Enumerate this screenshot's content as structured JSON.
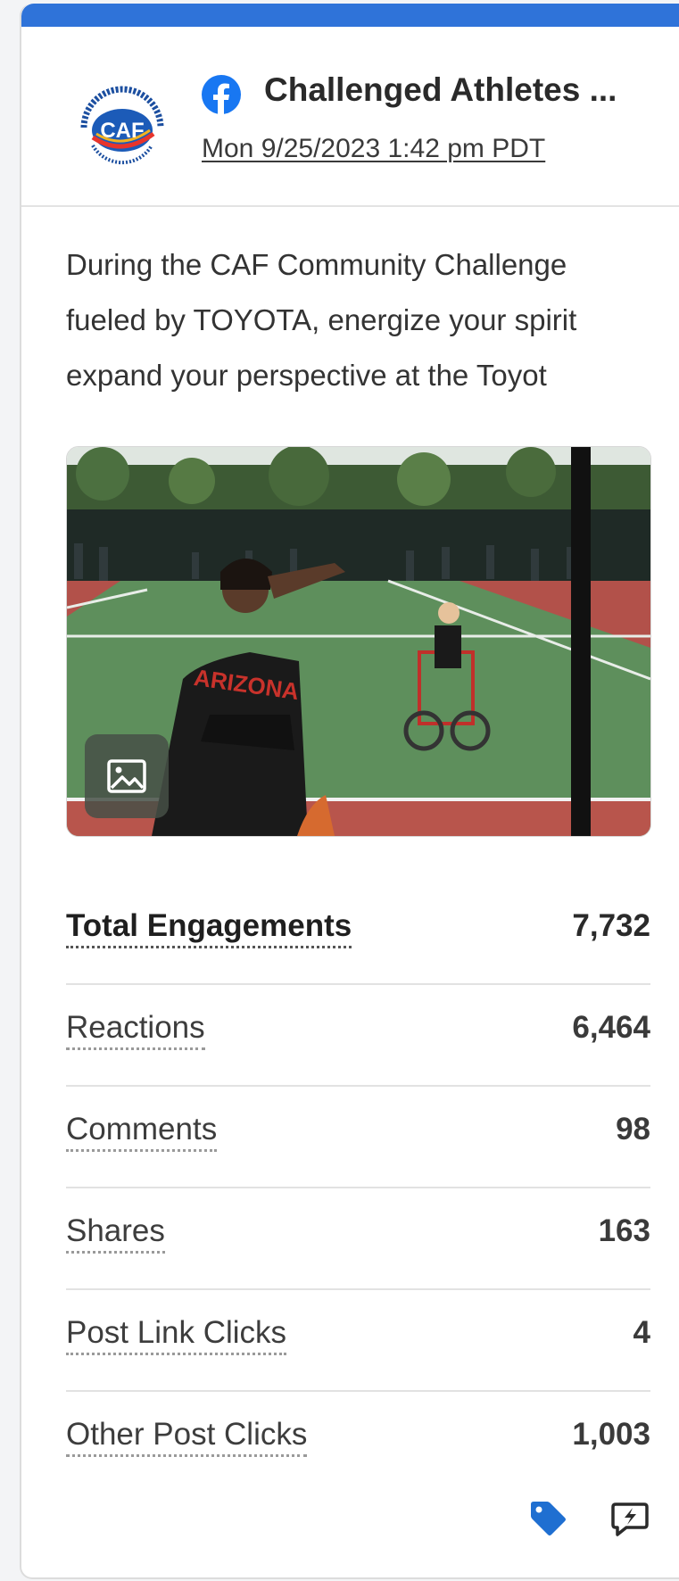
{
  "brand": {
    "accent_color": "#2f73d9",
    "facebook_color": "#1877f2",
    "logo_icon": "caf-foundation-logo",
    "logo_text": "CAF"
  },
  "post": {
    "network_icon": "facebook-icon",
    "page_name": "Challenged Athletes ...",
    "timestamp": "Mon 9/25/2023 1:42 pm PDT",
    "text_lines": [
      "During the CAF Community Challenge",
      "fueled by TOYOTA, energize your spirit",
      "expand your perspective at the Toyot"
    ],
    "media_type_icon": "image-icon"
  },
  "metrics": [
    {
      "label": "Total Engagements",
      "value": "7,732"
    },
    {
      "label": "Reactions",
      "value": "6,464"
    },
    {
      "label": "Comments",
      "value": "98"
    },
    {
      "label": "Shares",
      "value": "163"
    },
    {
      "label": "Post Link Clicks",
      "value": "4"
    },
    {
      "label": "Other Post Clicks",
      "value": "1,003"
    }
  ],
  "footer": {
    "tag_icon": "tag-icon",
    "reply_icon": "quick-reply-icon"
  }
}
